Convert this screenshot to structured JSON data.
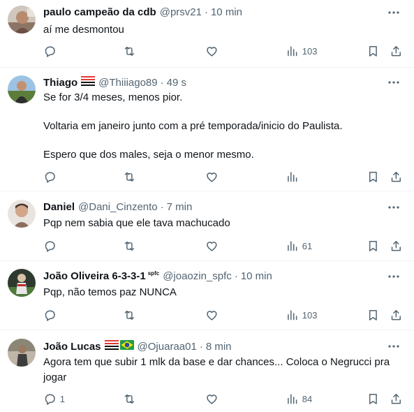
{
  "tweets": [
    {
      "name": "paulo campeão da cdb",
      "handle": "@prsv21",
      "sep": "·",
      "time": "10 min",
      "text": "aí me desmontou",
      "replies": "",
      "views": "103"
    },
    {
      "name": "Thiago",
      "handle": "@Thiiiago89",
      "sep": "·",
      "time": "49 s",
      "text": "Se for 3/4 meses, menos pior.\n\nVoltaria em janeiro junto com a pré temporada/inicio do Paulista.\n\nEspero que dos males, seja o menor mesmo.",
      "replies": "",
      "views": ""
    },
    {
      "name": "Daniel",
      "handle": "@Dani_Cinzento",
      "sep": "·",
      "time": "7 min",
      "text": "Pqp nem sabia que ele tava machucado",
      "replies": "",
      "views": "61"
    },
    {
      "name": "João Oliveira 6-3-3-1",
      "name_sup": "spfc",
      "handle": "@joaozin_spfc",
      "sep": "·",
      "time": "10 min",
      "text": "Pqp, não temos paz NUNCA",
      "replies": "",
      "views": "103"
    },
    {
      "name": "João Lucas",
      "handle": "@Ojuaraa01",
      "sep": "·",
      "time": "8 min",
      "text": "Agora tem que subir 1 mlk da base e dar chances... Coloca o Negrucci pra jogar",
      "replies": "1",
      "views": "84"
    }
  ],
  "icons": {
    "reply": "reply-icon",
    "retweet": "retweet-icon",
    "like": "heart-icon",
    "views": "views-icon",
    "bookmark": "bookmark-icon",
    "share": "share-icon",
    "more": "more-icon"
  },
  "colors": {
    "text": "#0f1419",
    "secondary": "#536471",
    "divider": "#eff3f4"
  }
}
